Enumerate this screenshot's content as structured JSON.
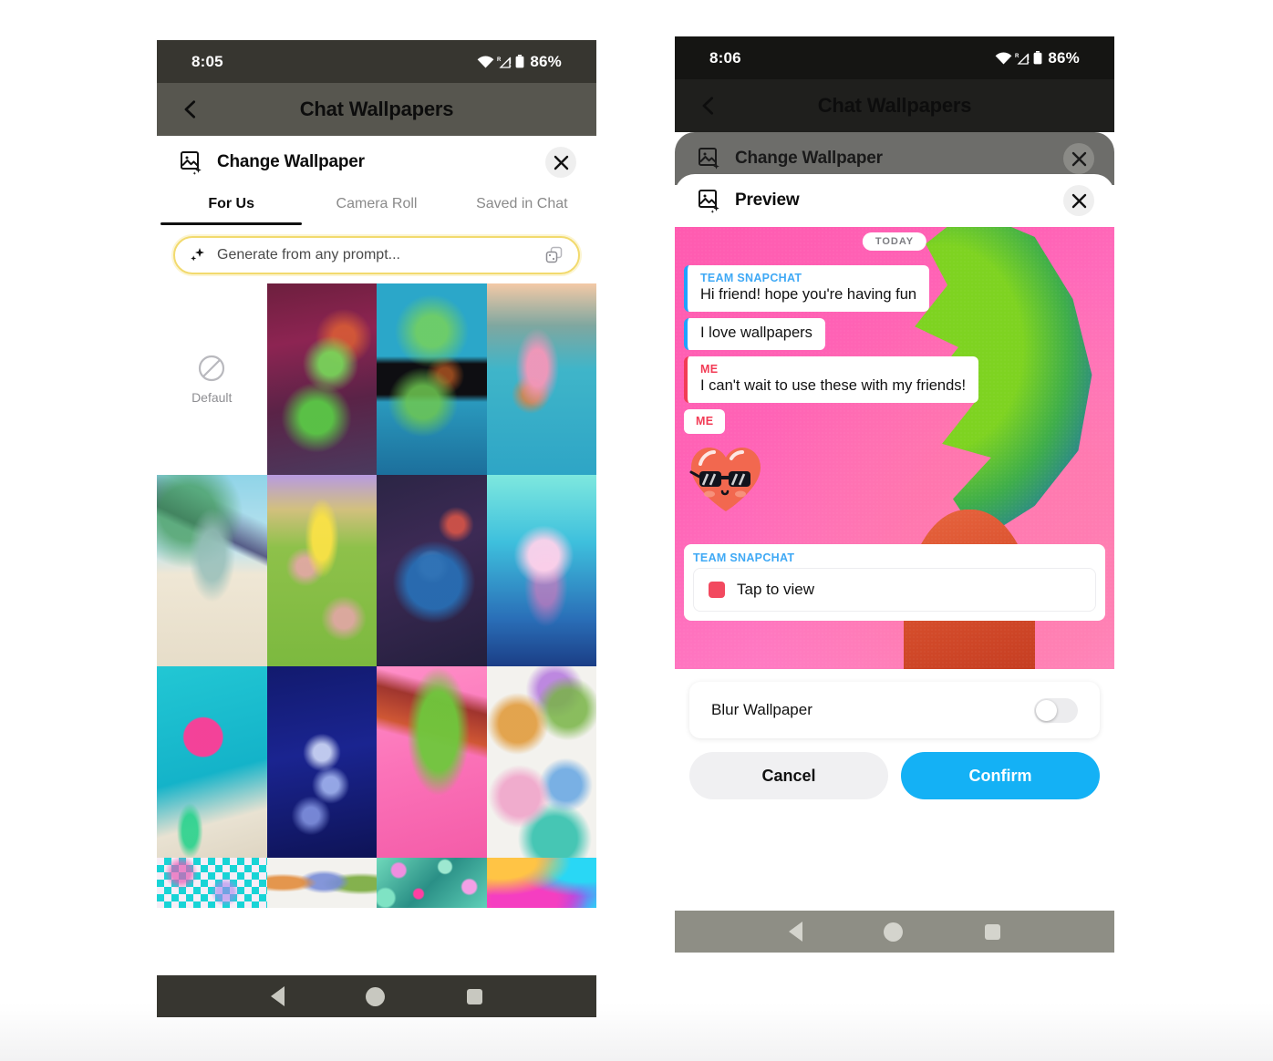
{
  "left_phone": {
    "status_bar": {
      "time": "8:05",
      "battery": "86%",
      "wifi_icon": "wifi-icon",
      "signal_icon": "cell-signal-icon",
      "battery_icon": "battery-icon"
    },
    "app_bar": {
      "title": "Chat Wallpapers",
      "back_icon": "back-chevron-icon"
    },
    "sheet": {
      "title": "Change Wallpaper",
      "icon": "wallpaper-sparkle-icon",
      "close_icon": "close-icon"
    },
    "tabs": [
      {
        "label": "For Us",
        "active": true
      },
      {
        "label": "Camera Roll",
        "active": false
      },
      {
        "label": "Saved in Chat",
        "active": false
      }
    ],
    "prompt": {
      "placeholder": "Generate from any prompt...",
      "sparkle_icon": "sparkles-icon",
      "trailing_icon": "dice-copy-icon",
      "border_color": "#f2da6e"
    },
    "default_cell": {
      "label": "Default",
      "icon": "no-entry-icon"
    },
    "wallpapers": [
      {
        "name": "tmnt-city",
        "row": 1
      },
      {
        "name": "tmnt-map",
        "row": 1
      },
      {
        "name": "patrick-water",
        "row": 1
      },
      {
        "name": "squidward-beach",
        "row": 2
      },
      {
        "name": "spongebob-hill",
        "row": 2
      },
      {
        "name": "astronaut-earth",
        "row": 2
      },
      {
        "name": "jellyfish-underwater",
        "row": 2
      },
      {
        "name": "flamingo-pool",
        "row": 3
      },
      {
        "name": "chrome-charms",
        "row": 3
      },
      {
        "name": "hand-monstera-leaf",
        "row": 3
      },
      {
        "name": "cat-doodles",
        "row": 3
      },
      {
        "name": "pixel-checker",
        "row": 4
      },
      {
        "name": "dog-doodles",
        "row": 4
      },
      {
        "name": "floral-pattern",
        "row": 4
      },
      {
        "name": "gradient-blur",
        "row": 4
      }
    ],
    "nav": {
      "back": "nav-back-icon",
      "home": "nav-home-icon",
      "recents": "nav-recents-icon"
    }
  },
  "right_phone": {
    "status_bar": {
      "time": "8:06",
      "battery": "86%"
    },
    "app_bar": {
      "title": "Chat Wallpapers",
      "back_icon": "back-chevron-icon"
    },
    "dimmed_sheet": {
      "title": "Change Wallpaper",
      "close_icon": "close-icon"
    },
    "sheet": {
      "title": "Preview",
      "icon": "wallpaper-sparkle-icon",
      "close_icon": "close-icon"
    },
    "preview": {
      "date_chip": "TODAY",
      "messages": [
        {
          "sender": "TEAM SNAPCHAT",
          "accent": "#3fa9f5",
          "text": "Hi friend! hope you're having fun"
        },
        {
          "sender": "",
          "accent": "#3fa9f5",
          "text": "I love wallpapers"
        },
        {
          "sender": "ME",
          "accent": "#f23b55",
          "text": "I can't wait to use these with my friends!"
        },
        {
          "sender": "ME",
          "accent": "#f23b55",
          "text": "",
          "sticker": "heart-sunglasses-sticker"
        }
      ],
      "snap_card": {
        "sender": "TEAM SNAPCHAT",
        "label": "Tap to view",
        "chip_color": "#f2495f"
      }
    },
    "blur_row": {
      "label": "Blur Wallpaper",
      "enabled": false
    },
    "buttons": {
      "cancel": "Cancel",
      "confirm": "Confirm",
      "confirm_color": "#14b1f5"
    },
    "nav": {
      "back": "nav-back-icon",
      "home": "nav-home-icon",
      "recents": "nav-recents-icon"
    }
  }
}
